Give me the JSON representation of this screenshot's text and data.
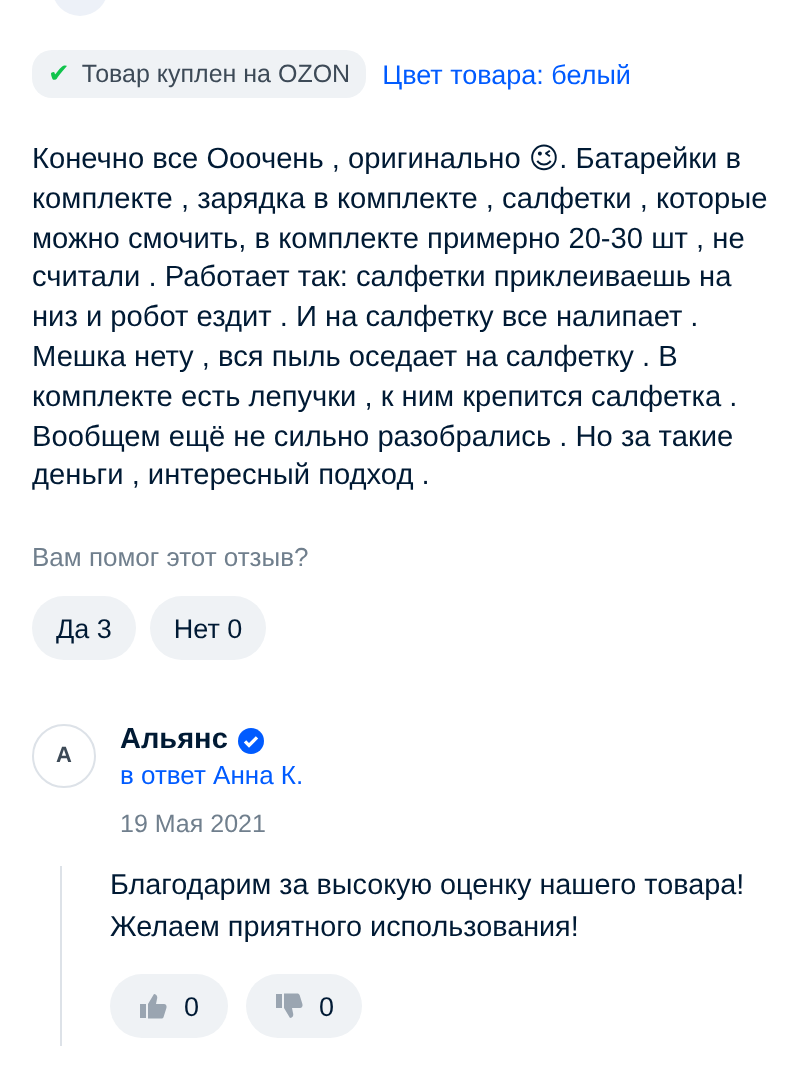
{
  "purchase_badge": {
    "icon": "✔",
    "label": "Товар куплен на OZON"
  },
  "product_color": "Цвет товара: белый",
  "review_text": "Конечно все Ооочень , оригинально 😉. Батарейки в комплекте , зарядка в комплекте , салфетки , которые можно смочить, в комплекте примерно 20-30 шт , не считали . Работает так: салфетки приклеиваешь на низ и робот ездит . И на салфетку все налипает . Мешка нету , вся пыль оседает на салфетку . В комплекте есть лепучки , к ним крепится салфетка . Вообщем ещё не сильно разобрались . Но за такие деньги , интересный подход .",
  "helpful_question": "Вам помог этот отзыв?",
  "helpful_buttons": [
    "Да 3",
    "Нет 0"
  ],
  "reply": {
    "avatar_letter": "А",
    "author": "Альянс",
    "verified": true,
    "in_reply_to": "в ответ Анна К.",
    "date": "19 Мая 2021",
    "text": "Благодарим за высокую оценку нашего товара! Желаем приятного использования!",
    "votes": [
      {
        "kind": "like",
        "count": "0"
      },
      {
        "kind": "dislike",
        "count": "0"
      }
    ]
  }
}
